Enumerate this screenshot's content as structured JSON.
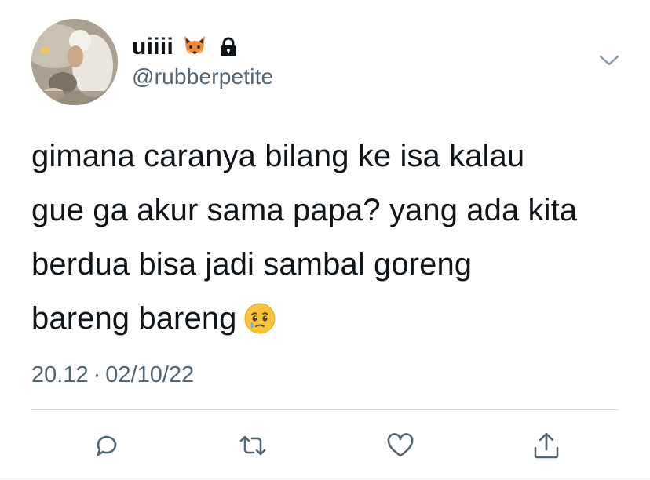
{
  "user": {
    "display_name": "uiiii",
    "handle": "@rubberpetite",
    "avatar": "profile-photo",
    "badges": [
      "fox-emoji",
      "lock-icon"
    ]
  },
  "tweet": {
    "lines": [
      "gimana caranya bilang ke isa kalau",
      "gue ga akur sama papa? yang ada kita",
      "berdua bisa jadi sambal goreng",
      "bareng bareng"
    ],
    "trailing_emoji": "face-holding-back-tears"
  },
  "meta": {
    "time": "20.12",
    "separator": "·",
    "date": "02/10/22"
  },
  "actions": [
    "reply-icon",
    "retweet-icon",
    "like-icon",
    "share-icon"
  ],
  "colors": {
    "text": "#0f1419",
    "secondary": "#536471",
    "divider": "#cfd9de"
  }
}
